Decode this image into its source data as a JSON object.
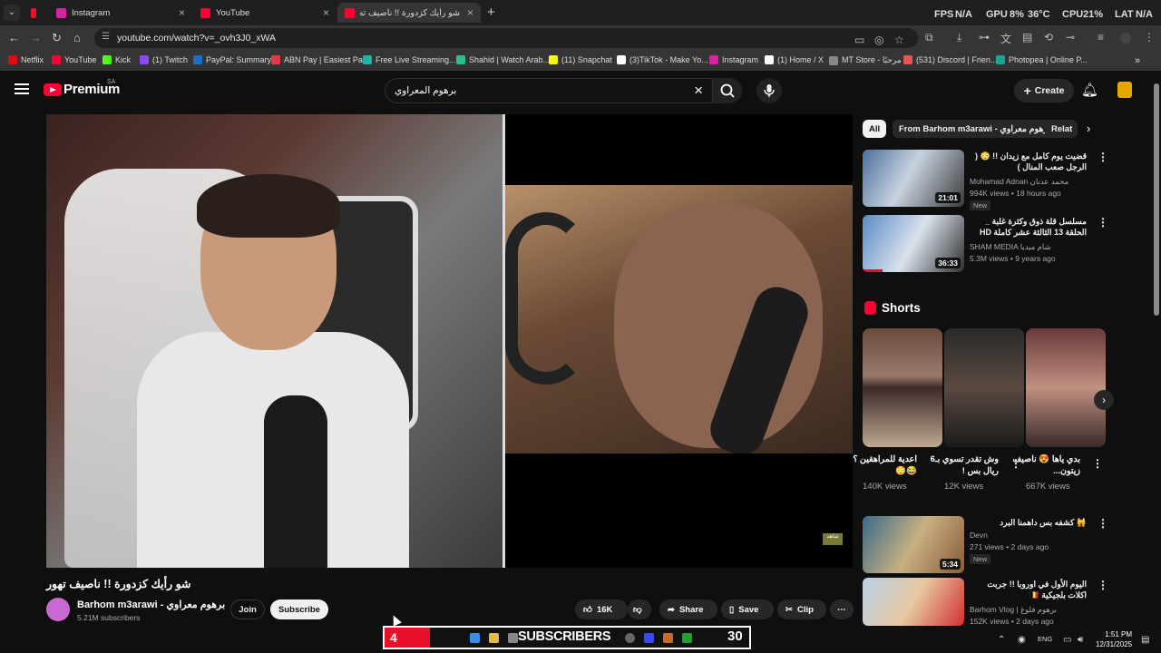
{
  "browser": {
    "tabs": [
      {
        "label": "Instagram",
        "color": "#d6249f"
      },
      {
        "label": "YouTube",
        "color": "#ff0033"
      },
      {
        "label": "شو رأيك كزدورة !! ناصيف ته",
        "color": "#ff0033"
      }
    ],
    "perf": {
      "fps_label": "FPS",
      "fps": "N/A",
      "gpu_label": "GPU",
      "gpu": "8%",
      "gpu_temp": "36°C",
      "cpu_label": "CPU",
      "cpu": "21%",
      "lat_label": "LAT",
      "lat": "N/A"
    },
    "url": "youtube.com/watch?v=_ovh3J0_xWA",
    "bookmarks": [
      {
        "label": "Netflix",
        "color": "#e50914"
      },
      {
        "label": "YouTube",
        "color": "#ff0033"
      },
      {
        "label": "Kick",
        "color": "#53fc18"
      },
      {
        "label": "(1) Twitch",
        "color": "#9146ff"
      },
      {
        "label": "PayPal: Summary",
        "color": "#1a70c9"
      },
      {
        "label": "ABN Pay | Easiest Pa...",
        "color": "#e63946"
      },
      {
        "label": "Free Live Streaming...",
        "color": "#1fb5a6"
      },
      {
        "label": "Shahid | Watch Arab...",
        "color": "#2dbd8f"
      },
      {
        "label": "(11) Snapchat",
        "color": "#fffc00"
      },
      {
        "label": "(3)TikTok - Make Yo...",
        "color": "#ffffff"
      },
      {
        "label": "Instagram",
        "color": "#d6249f"
      },
      {
        "label": "(1) Home / X",
        "color": "#ffffff"
      },
      {
        "label": "MT Store - مرحبًا",
        "color": "#888888"
      },
      {
        "label": "(531) Discord | Frien...",
        "color": "#e8564f"
      },
      {
        "label": "Photopea | Online P...",
        "color": "#18a497"
      }
    ]
  },
  "youtube": {
    "brand": "Premium",
    "country": "SA",
    "search_query": "برهوم المعراوي",
    "create_label": "Create",
    "video": {
      "title": "شو رأيك كزدورة !! ناصيف تهور",
      "channel": "Barhom m3arawi - برهوم معراوي",
      "subscribers": "5.21M subscribers",
      "join_label": "Join",
      "subscribe_label": "Subscribe",
      "likes": "16K",
      "share_label": "Share",
      "save_label": "Save",
      "clip_label": "Clip"
    },
    "chips": [
      "All",
      "From Barhom m3arawi - برهوم معراوي",
      "Relat"
    ],
    "related": [
      {
        "title": "قضيت يوم كامل مع زيدان !! 😳 ( الرجل صعب المنال )",
        "channel": "Mohamad Adnan محمد عدنان",
        "meta": "994K views • 18 hours ago",
        "badge": "New",
        "duration": "21:01"
      },
      {
        "title": "مسلسل قلة ذوق وكثرة غلبة _ الحلقة 13 الثالثة عشر كاملة HD",
        "channel": "SHAM MEDIA شام ميديا",
        "meta": "5.3M views • 9 years ago",
        "badge": "",
        "duration": "36:33"
      }
    ],
    "shorts_title": "Shorts",
    "shorts": [
      {
        "title": "اعدية للمراهقين ؟ 😂😳",
        "views": "140K views"
      },
      {
        "title": "وش تقدر تسوي بـ6 ريال بس !",
        "views": "12K views"
      },
      {
        "title": "بدي ياها 😍 ناصيف زيتون...",
        "views": "667K views"
      }
    ],
    "more": [
      {
        "title": "🙀 كشفه بس داهمنا البرد",
        "channel": "Devn",
        "meta": "271 views • 2 days ago",
        "badge": "New",
        "duration": "5:34"
      },
      {
        "title": "اليوم الأول في اوروبا !! جربت اكلات بلجيكية 🇧🇪",
        "channel": "Barhom Vlog | برهوم فلوغ",
        "meta": "152K views • 2 days ago",
        "badge": "",
        "duration": ""
      }
    ],
    "watermark": "شاهد"
  },
  "taskbar": {
    "counter_left": "4",
    "subs_label": "SUBSCRIBERS",
    "counter_right": "30",
    "lang": "ENG",
    "time": "1:51 PM",
    "date": "12/31/2025"
  }
}
